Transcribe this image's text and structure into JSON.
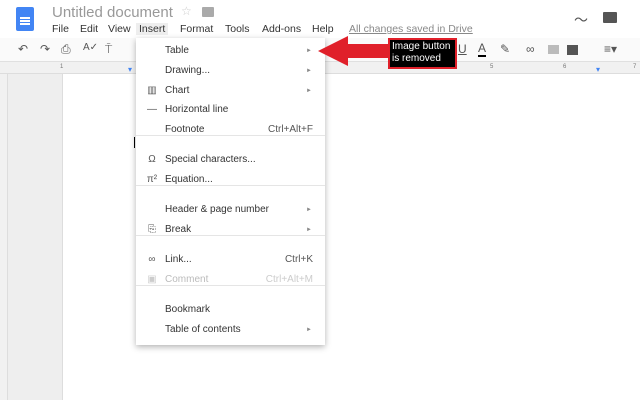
{
  "app": {
    "title": "Untitled document",
    "saved_status": "All changes saved in Drive"
  },
  "menubar": [
    "File",
    "Edit",
    "View",
    "Insert",
    "Format",
    "Tools",
    "Add-ons",
    "Help"
  ],
  "ruler": [
    "1",
    "5",
    "6",
    "7"
  ],
  "insert_menu": [
    {
      "icon": "",
      "label": "Table",
      "arrow": true
    },
    {
      "icon": "",
      "label": "Drawing...",
      "arrow": true
    },
    {
      "icon": "▥",
      "label": "Chart",
      "arrow": true
    },
    {
      "icon": "—",
      "label": "Horizontal line"
    },
    {
      "icon": "",
      "label": "Footnote",
      "shortcut": "Ctrl+Alt+F"
    },
    {
      "icon": "Ω",
      "label": "Special characters..."
    },
    {
      "icon": "π²",
      "label": "Equation..."
    },
    {
      "icon": "",
      "label": "Header & page number",
      "arrow": true
    },
    {
      "icon": "⎘",
      "label": "Break",
      "arrow": true
    },
    {
      "icon": "∞",
      "label": "Link...",
      "shortcut": "Ctrl+K"
    },
    {
      "icon": "▣",
      "label": "Comment",
      "shortcut": "Ctrl+Alt+M",
      "disabled": true
    },
    {
      "icon": "",
      "label": "Bookmark"
    },
    {
      "icon": "",
      "label": "Table of contents",
      "arrow": true
    }
  ],
  "annotation": {
    "text": "Image button is removed",
    "color": "#e0202a"
  }
}
